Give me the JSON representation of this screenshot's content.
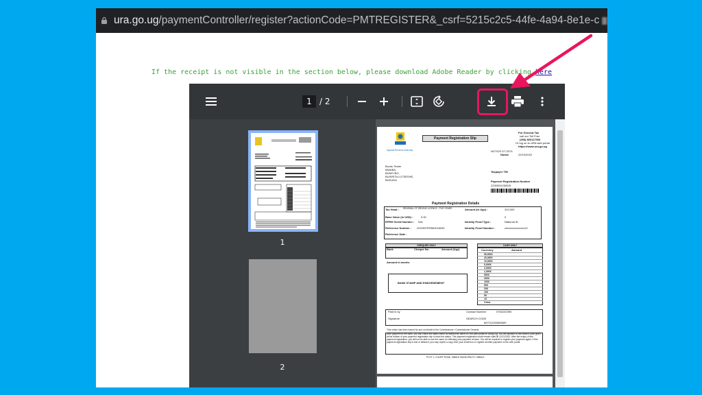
{
  "address_bar": {
    "host": "ura.go.ug",
    "path": "/paymentController/register?actionCode=PMTREGISTER&_csrf=5215c2c5-44fe-4a94-8e1e-c"
  },
  "notice": {
    "text": "If the receipt is not visible in the section below, please download Adobe Reader by clicking",
    "link": "here"
  },
  "pdf_viewer": {
    "current_page": "1",
    "total_pages": "/ 2",
    "thumbnails": [
      {
        "label": "1"
      },
      {
        "label": "2"
      }
    ],
    "toolbar_icons": [
      "menu-icon",
      "zoom-out-icon",
      "zoom-in-icon",
      "fit-page-icon",
      "rotate-icon",
      "download-icon",
      "print-icon",
      "more-icon"
    ]
  },
  "receipt": {
    "title": "Payment Registration Slip",
    "org": "Uganda Revenue Authority",
    "right_header": [
      "For General Tax",
      "call our Toll Free",
      "(256) 800117000",
      "Or log on to URA web portal",
      "https://www.ura.go.ug"
    ],
    "notice_label": "NOTICE DT-2074",
    "notice_date_label": "Notice",
    "notice_date": "22/10/2022",
    "taxpayer_lines": [
      "Buvdu Tester",
      "MWABA,",
      "BUNEYBO,",
      "BUSIRITA LUTSESHE,",
      "BUDUDA"
    ],
    "taxpayer_tin_label": "Taxpayer TIN",
    "prn_label": "Payment Registration Number",
    "prn": "2230004130828",
    "details_title": "Payment Registration Details",
    "tax_head_label": "Tax Head :",
    "tax_head_value": "RENEWAL OF DRIVING LICENCE - FIVE YEARS",
    "amount_label": "Amount (in Ugx) :",
    "amount_value": "310,000",
    "base_value_label": "Base Value (in USD) :",
    "base_value": "0.00",
    "zero": "0",
    "efris_label": "EFRIS Serial Number :",
    "efris_value": "N/A",
    "id_type_label": "Identity Proof Type :",
    "id_type_value": "National ID",
    "ref_label": "Reference Number :",
    "ref_value": "2022INTERMH018030",
    "id_no_label": "Identity Proof Number :",
    "id_no_value": "cmxxxxxxxxxxxx12",
    "ref_date_label": "Reference Date :",
    "cheques_title": "CHEQUES ONLY",
    "cheque_cols": [
      "Bank",
      "Cheque No",
      "Amount (Ugx)"
    ],
    "cash_title": "CASH ONLY",
    "cash_cols": [
      "Currency",
      "Amount"
    ],
    "cash_denoms": [
      "50,000X",
      "20,000X",
      "10,000X",
      "5,000X",
      "2,000X",
      "1,000X",
      "500X",
      "200X",
      "100X",
      "50X",
      "20X",
      "10X",
      "5X",
      "1X",
      "Coins"
    ],
    "amount_words_label": "Amount in words:",
    "bank_stamp": "BANK STAMP AND ENDORSEMENT",
    "paid_in_by": "Paid in by",
    "contact_label": "Contact Number",
    "contact_value": "0763102390",
    "signature_label": "Signature",
    "search_code_label": "SEARCH CODE",
    "search_code_value": "667101000656MX",
    "commissioner_note": "This notice has been issued for and on behalf of the Commissioner / Commissioner General",
    "footer_text": "After payment to the bank, you can check the status either at nearest tax office or URA web portal on ura.go.ug. You are advised to use search code given at the bottom of your payment registration slip to track the status. This payment registration shall remain valid till 12/11/2022. After the expiry of this payment registration, you will not be able to use the same for effecting your payment at bank. You will be required to register your payment again. If this payment registration slip is lost or defaced, you may reprint a copy from your email box or register another payment on the web portal.",
    "address": "PLOT 1, COURT ROAD, MBALE MUNICIPALITY, MBALE"
  }
}
